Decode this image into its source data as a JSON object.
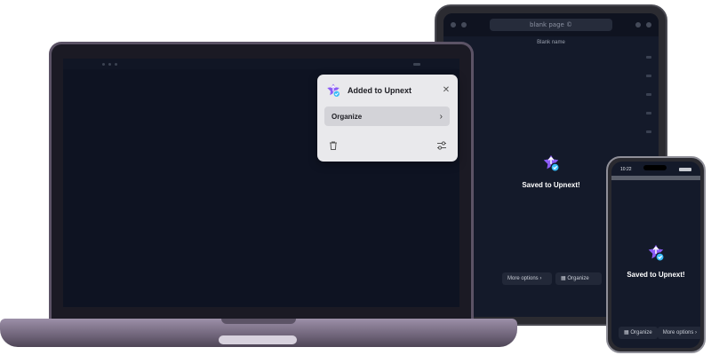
{
  "tablet": {
    "url": "blank page ©",
    "subbar": "Blank name",
    "saved_text": "Saved to Upnext!",
    "more_options_label": "More options ›",
    "organize_label": "Organize"
  },
  "popup": {
    "title": "Added to Upnext",
    "organize_label": "Organize",
    "close_icon": "close-icon",
    "trash_icon": "trash-icon",
    "settings_icon": "sliders-icon"
  },
  "phone": {
    "time": "10:22",
    "saved_text": "Saved to Upnext!",
    "organize_label": "Organize",
    "more_options_label": "More options ›"
  },
  "colors": {
    "brand": "#8b5cf6",
    "badge": "#38bdf8",
    "screen_bg": "#0e1322"
  }
}
